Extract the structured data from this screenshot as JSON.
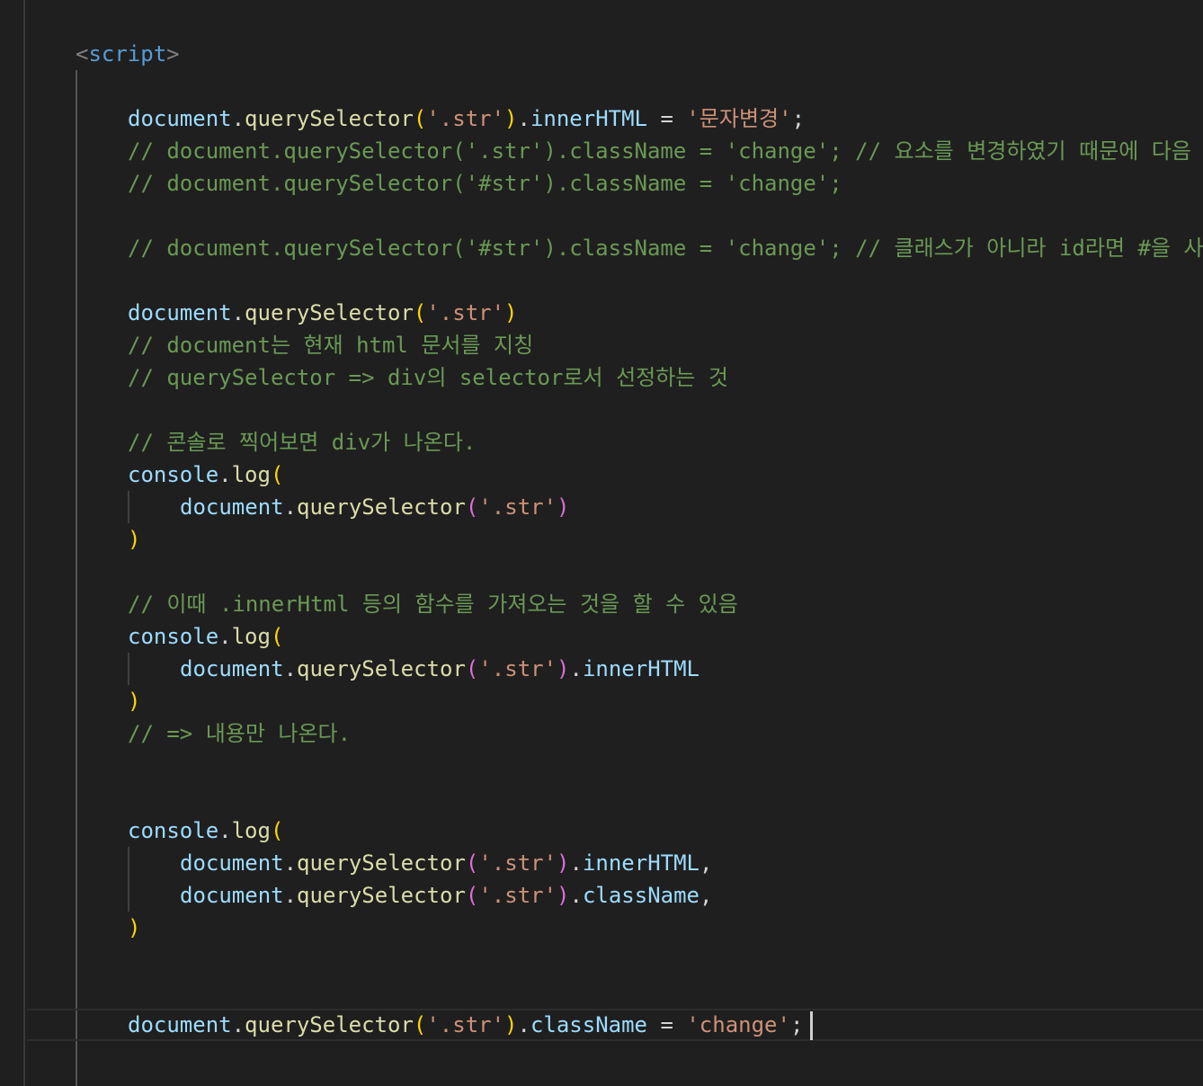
{
  "editor": {
    "lines": {
      "script_open": {
        "lt": "<",
        "name": "script",
        "gt": ">"
      },
      "l1": {
        "obj": "document",
        "dot": ".",
        "fn": "querySelector",
        "open": "(",
        "str": "'.str'",
        "close": ")",
        "dot2": ".",
        "prop": "innerHTML",
        "eq": " = ",
        "val": "'문자변경'",
        "semi": ";"
      },
      "c1": "// document.querySelector('.str').className = 'change'; // 요소를 변경하였기 때문에 다음 문",
      "c2": "// document.querySelector('#str').className = 'change';",
      "c3": "// document.querySelector('#str').className = 'change'; // 클래스가 아니라 id라면 #을 사용",
      "l2": {
        "obj": "document",
        "dot": ".",
        "fn": "querySelector",
        "open": "(",
        "str": "'.str'",
        "close": ")"
      },
      "c4": "// document는 현재 html 문서를 지칭",
      "c5": "// querySelector => div의 selector로서 선정하는 것",
      "c6": "// 콘솔로 찍어보면 div가 나온다.",
      "log1": {
        "obj": "console",
        "dot": ".",
        "fn": "log",
        "open": "("
      },
      "log1_arg": {
        "obj": "document",
        "dot": ".",
        "fn": "querySelector",
        "open": "(",
        "str": "'.str'",
        "close": ")"
      },
      "log1_close": ")",
      "c7": "// 이때 .innerHtml 등의 함수를 가져오는 것을 할 수 있음",
      "log2": {
        "obj": "console",
        "dot": ".",
        "fn": "log",
        "open": "("
      },
      "log2_arg": {
        "obj": "document",
        "dot": ".",
        "fn": "querySelector",
        "open": "(",
        "str": "'.str'",
        "close": ")",
        "dot2": ".",
        "prop": "innerHTML"
      },
      "log2_close": ")",
      "c8": "// => 내용만 나온다.",
      "log3": {
        "obj": "console",
        "dot": ".",
        "fn": "log",
        "open": "("
      },
      "log3_arg1": {
        "obj": "document",
        "dot": ".",
        "fn": "querySelector",
        "open": "(",
        "str": "'.str'",
        "close": ")",
        "dot2": ".",
        "prop": "innerHTML",
        "comma": ","
      },
      "log3_arg2": {
        "obj": "document",
        "dot": ".",
        "fn": "querySelector",
        "open": "(",
        "str": "'.str'",
        "close": ")",
        "dot2": ".",
        "prop": "className",
        "comma": ","
      },
      "log3_close": ")",
      "last": {
        "obj": "document",
        "dot": ".",
        "fn": "querySelector",
        "open": "(",
        "str": "'.str'",
        "close": ")",
        "dot2": ".",
        "prop": "className",
        "eq": " = ",
        "val": "'change'",
        "semi": ";"
      }
    },
    "colors": {
      "background": "#1f1f1f",
      "comment": "#6a9955",
      "string": "#ce9178",
      "function": "#dcdcaa",
      "variable": "#9cdcfe",
      "tag": "#569cd6",
      "bracket_level1": "#ffd700",
      "bracket_level2": "#da70d6"
    }
  }
}
